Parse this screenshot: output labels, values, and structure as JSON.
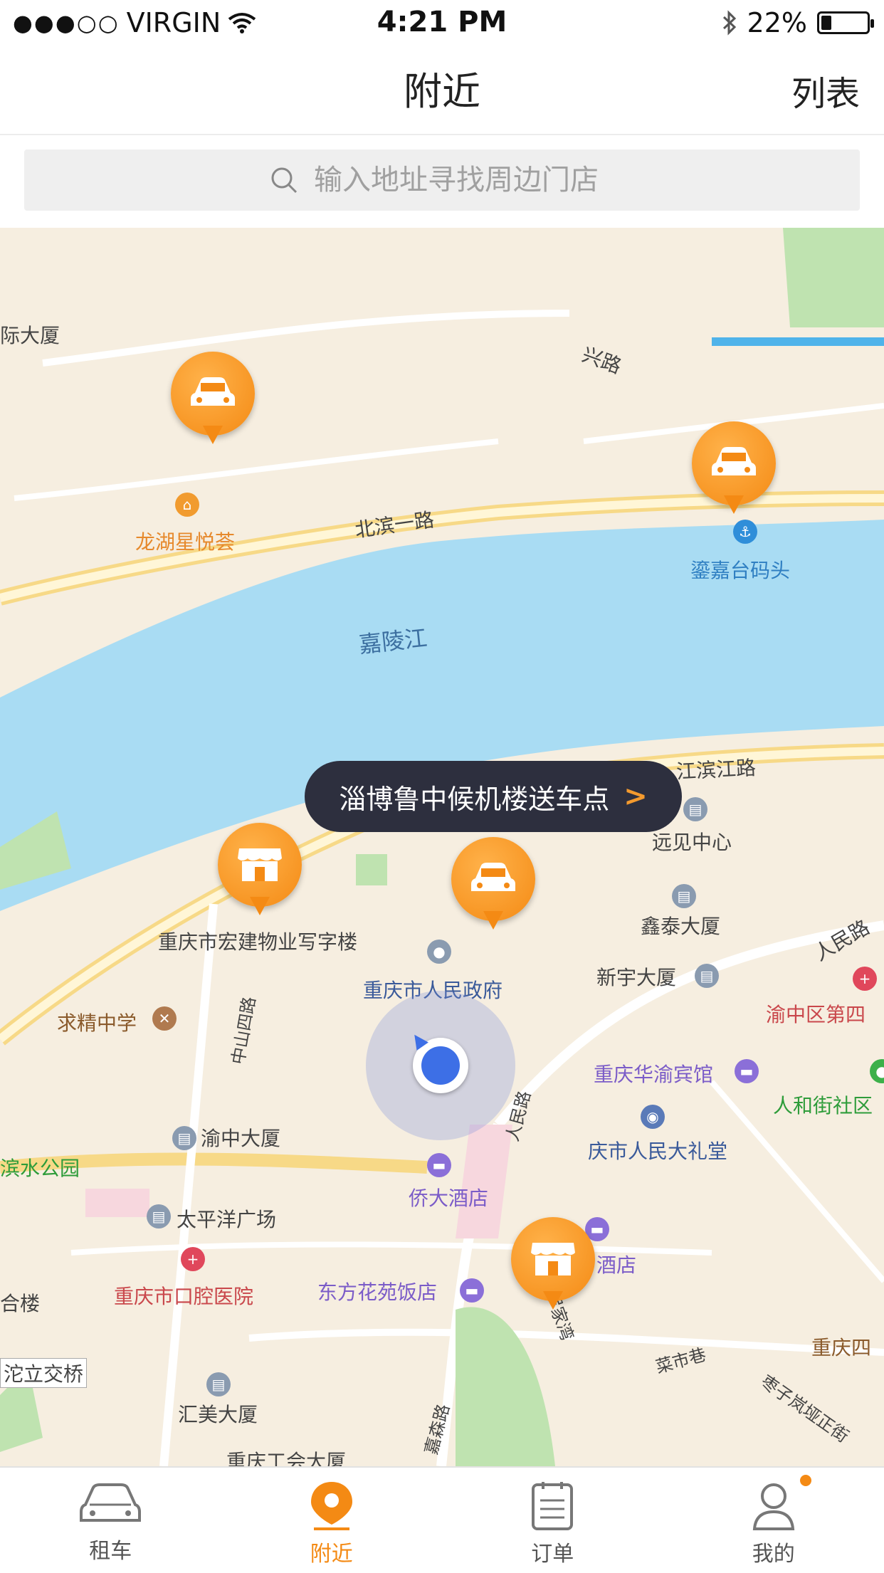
{
  "status_bar": {
    "signal_dots": "●●●○○",
    "carrier": "VIRGIN",
    "time": "4:21 PM",
    "battery_pct": "22%",
    "battery_level": 0.22
  },
  "nav": {
    "title": "附近",
    "right_label": "列表"
  },
  "search": {
    "placeholder": "输入地址寻找周边门店"
  },
  "map": {
    "labels": {
      "intl_building": "际大厦",
      "xing_road": "兴路",
      "longhu": "龙湖星悦荟",
      "beibin_road": "北滨一路",
      "wharf": "鎏嘉台码头",
      "river": "嘉陵江",
      "binjiang_road": "江滨江路",
      "yuanjian": "远见中心",
      "hongjian": "重庆市宏建物业写字楼",
      "xintai": "鑫泰大厦",
      "renmin_road": "人民路",
      "gov": "重庆市人民政府",
      "xinyu": "新宇大厦",
      "yuzhong_hosp": "渝中区第四",
      "qiujing": "求精中学",
      "zhongshan_road": "中山四路",
      "huayu_hotel": "重庆华渝宾馆",
      "renhe": "人和街社区",
      "renmin_road2": "人民路",
      "yuzhong_bldg": "渝中大厦",
      "auditorium": "庆市人民大礼堂",
      "binshui_park": "滨水公园",
      "qiaoda": "侨大酒店",
      "taipingyang": "太平洋广场",
      "hotel2": "酒店",
      "he_building": "合楼",
      "dental": "重庆市口腔医院",
      "dongfang": "东方花苑饭店",
      "luojiawan": "罗家湾",
      "chongqing_si": "重庆四",
      "overpass": "沱立交桥",
      "caishi": "菜市巷",
      "huimei": "汇美大厦",
      "zaozi": "枣子岚垭正街",
      "union_bldg": "重庆工会大厦",
      "jiaogang_road": "嘉森路"
    },
    "tooltip": {
      "text": "淄博鲁中候机楼送车点",
      "chevron": ">"
    }
  },
  "tabs": [
    {
      "label": "租车",
      "icon": "car-icon",
      "active": false
    },
    {
      "label": "附近",
      "icon": "location-pin-icon",
      "active": true
    },
    {
      "label": "订单",
      "icon": "clipboard-icon",
      "active": false
    },
    {
      "label": "我的",
      "icon": "user-icon",
      "active": false,
      "badge": true
    }
  ],
  "colors": {
    "accent": "#f48a14",
    "river": "#a9dcf3",
    "land": "#f6eee0",
    "tooltip_bg": "#2d2f3e"
  }
}
